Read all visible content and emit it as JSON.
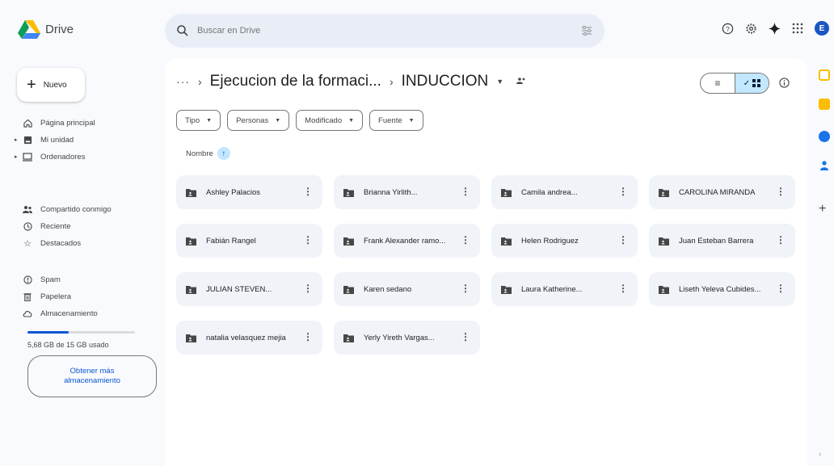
{
  "app": {
    "name": "Drive"
  },
  "search": {
    "placeholder": "Buscar en Drive"
  },
  "header_icons": [
    "help-icon",
    "settings-icon",
    "gemini-icon",
    "apps-icon"
  ],
  "user": {
    "initial": "E",
    "avatar_color": "#1a56c4"
  },
  "sidebar": {
    "new_label": "Nuevo",
    "items": [
      {
        "label": "Página principal",
        "icon": "home-icon"
      },
      {
        "label": "Mi unidad",
        "icon": "my-drive-icon"
      },
      {
        "label": "Ordenadores",
        "icon": "computers-icon"
      },
      {
        "label": "Compartido conmigo",
        "icon": "shared-icon"
      },
      {
        "label": "Reciente",
        "icon": "clock-icon"
      },
      {
        "label": "Destacados",
        "icon": "star-icon"
      },
      {
        "label": "Spam",
        "icon": "spam-icon"
      },
      {
        "label": "Papelera",
        "icon": "trash-icon"
      },
      {
        "label": "Almacenamiento",
        "icon": "cloud-icon"
      }
    ],
    "storage_used_text": "5,68 GB de 15 GB usado",
    "storage_used_fraction": 0.38,
    "get_storage_label": "Obtener más almacenamiento"
  },
  "breadcrumb": {
    "more": "···",
    "parent": "Ejecucion de la formaci...",
    "current": "INDUCCION"
  },
  "filters": [
    {
      "label": "Tipo"
    },
    {
      "label": "Personas"
    },
    {
      "label": "Modificado"
    },
    {
      "label": "Fuente"
    }
  ],
  "sort": {
    "label": "Nombre"
  },
  "folders": [
    "Ashley Palacios",
    "Brianna Yirlith...",
    "Camila andrea...",
    "CAROLINA MIRANDA",
    "Fabián Rangel",
    "Frank Alexander ramo...",
    "Helen Rodriguez",
    "Juan Esteban Barrera",
    "JULIAN STEVEN...",
    "Karen sedano",
    "Laura Katherine...",
    "Liseth Yeleva Cubides...",
    "natalia velasquez mejia",
    "Yerly Yireth Vargas..."
  ],
  "colors": {
    "accent": "#0b57d0",
    "selected": "#c2e7ff",
    "folder_bg": "#f0f4f9",
    "surface": "#f8fafd"
  }
}
